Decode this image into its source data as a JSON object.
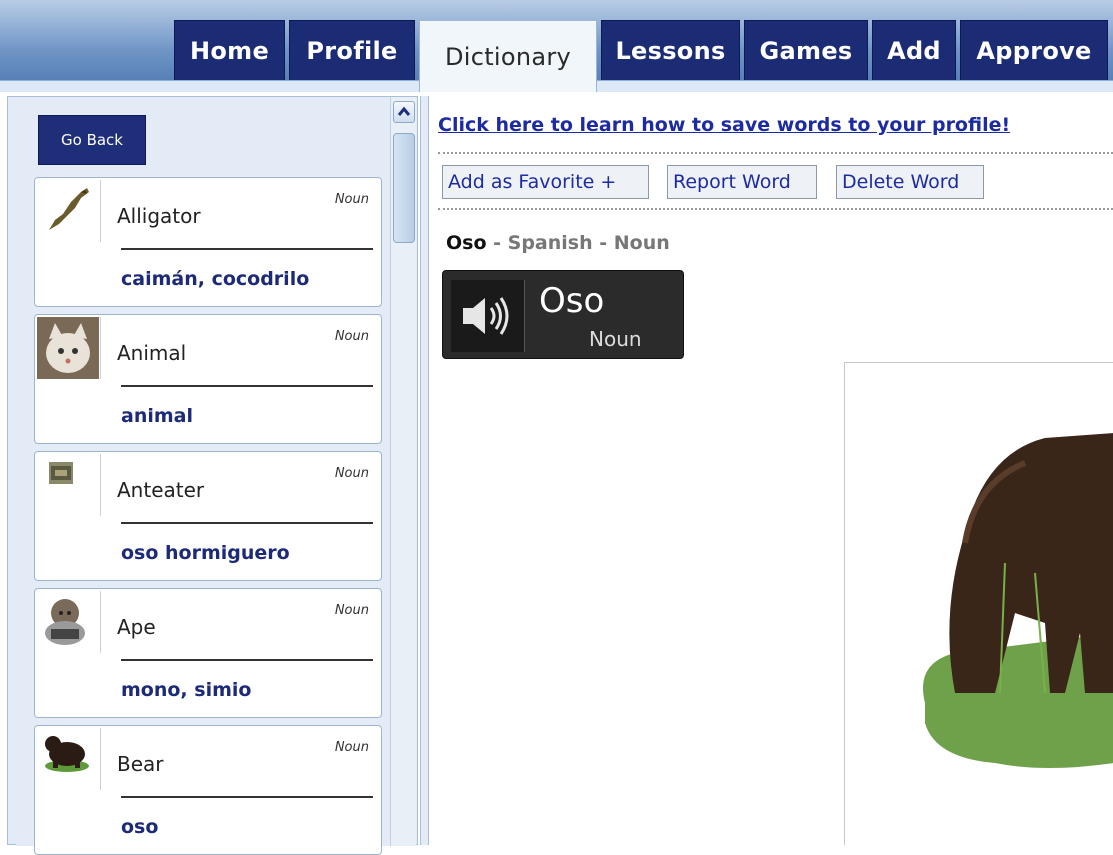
{
  "nav": {
    "tabs": [
      {
        "label": "Home"
      },
      {
        "label": "Profile"
      },
      {
        "label": "Dictionary",
        "active": true
      },
      {
        "label": "Lessons"
      },
      {
        "label": "Games"
      },
      {
        "label": "Add"
      },
      {
        "label": "Approve"
      }
    ]
  },
  "sidebar": {
    "go_back": "Go Back",
    "words": [
      {
        "word": "Alligator",
        "pos": "Noun",
        "translation": "caimán, cocodrilo",
        "icon": "alligator-icon"
      },
      {
        "word": "Animal",
        "pos": "Noun",
        "translation": "animal",
        "icon": "animal-icon"
      },
      {
        "word": "Anteater",
        "pos": "Noun",
        "translation": "oso hormiguero",
        "icon": "anteater-icon"
      },
      {
        "word": "Ape",
        "pos": "Noun",
        "translation": "mono, simio",
        "icon": "ape-icon"
      },
      {
        "word": "Bear",
        "pos": "Noun",
        "translation": "oso",
        "icon": "bear-icon"
      }
    ]
  },
  "main": {
    "learn_link": "Click here to learn how to save words to your profile!",
    "actions": {
      "favorite": "Add as Favorite +",
      "report": "Report Word",
      "delete": "Delete Word"
    },
    "entry": {
      "word": "Oso",
      "language": "Spanish",
      "pos": "Noun",
      "separator": " - "
    },
    "audio": {
      "word": "Oso",
      "pos": "Noun",
      "icon": "speaker-icon"
    },
    "image": {
      "icon": "bear-photo"
    }
  },
  "colors": {
    "nav_tab": "#1b2c74",
    "link": "#1d2ba0",
    "translation": "#1c2a78",
    "sidebar_bg": "#e3ecf6"
  }
}
